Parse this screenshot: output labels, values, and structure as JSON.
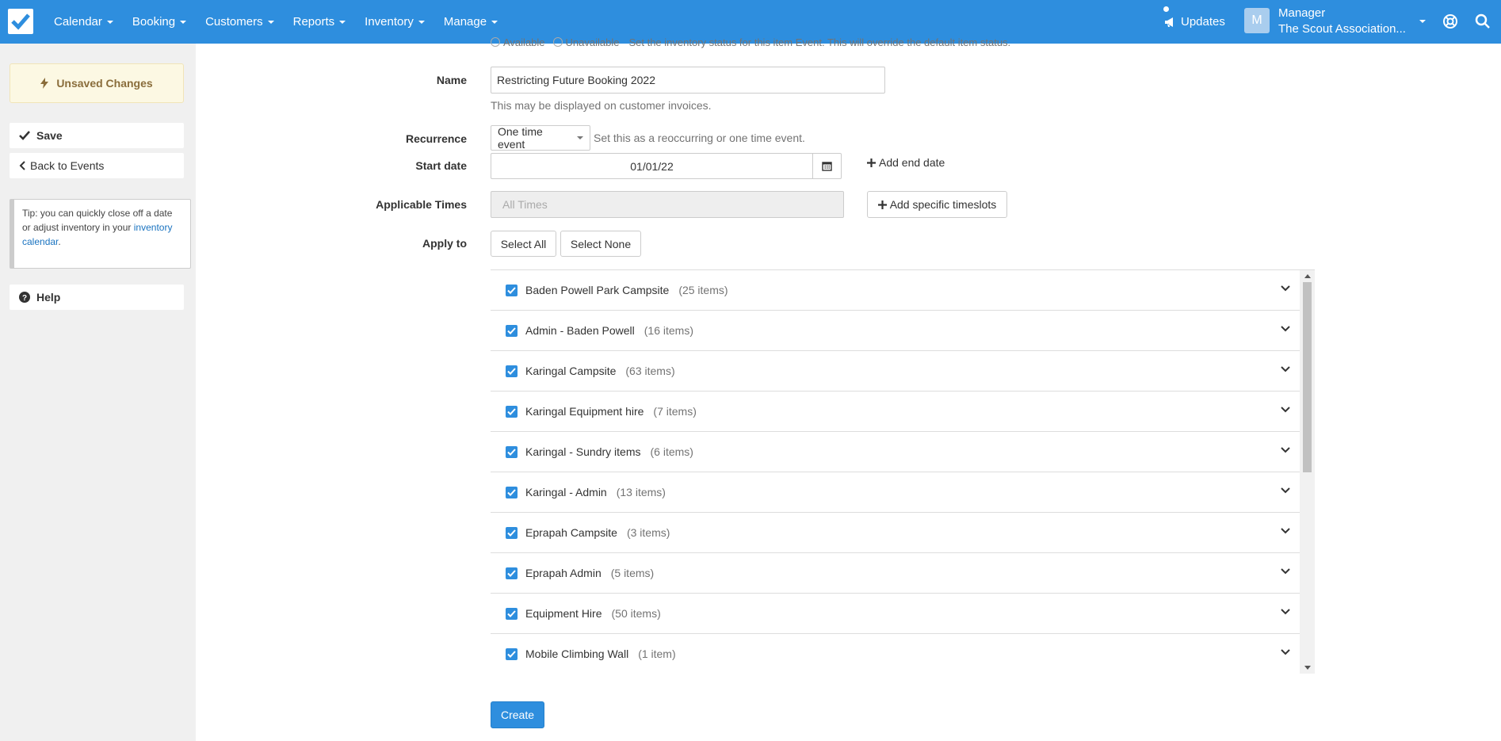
{
  "nav": {
    "items": [
      "Calendar",
      "Booking",
      "Customers",
      "Reports",
      "Inventory",
      "Manage"
    ],
    "updates": "Updates",
    "account": {
      "initial": "M",
      "role": "Manager",
      "org": "The Scout Association..."
    },
    "colors": {
      "bar": "#2e8ede"
    }
  },
  "sidebar": {
    "unsaved": "Unsaved Changes",
    "save": "Save",
    "back": "Back to Events",
    "tip": {
      "text": "Tip: you can quickly close off a date or adjust inventory in your",
      "link": "inventory calendar",
      "end": "."
    },
    "help": "Help"
  },
  "form": {
    "status": {
      "available": "Available",
      "unavailable": "Unavailable",
      "help": "Set the inventory status for this item Event. This will override the default item status."
    },
    "name": {
      "label": "Name",
      "value": "Restricting Future Booking 2022",
      "help": "This may be displayed on customer invoices."
    },
    "recurrence": {
      "label": "Recurrence",
      "value": "One time event",
      "help": "Set this as a reoccurring or one time event."
    },
    "start_date": {
      "label": "Start date",
      "value": "01/01/22",
      "add_end": "Add end date"
    },
    "times": {
      "label": "Applicable Times",
      "placeholder": "All Times",
      "add": "Add specific timeslots"
    },
    "apply": {
      "label": "Apply to",
      "select_all": "Select All",
      "select_none": "Select None"
    },
    "create": "Create"
  },
  "apply_list": [
    {
      "name": "Baden Powell Park Campsite",
      "count": "(25 items)",
      "checked": true
    },
    {
      "name": "Admin - Baden Powell",
      "count": "(16 items)",
      "checked": true
    },
    {
      "name": "Karingal Campsite",
      "count": "(63 items)",
      "checked": true
    },
    {
      "name": "Karingal Equipment hire",
      "count": "(7 items)",
      "checked": true
    },
    {
      "name": "Karingal - Sundry items",
      "count": "(6 items)",
      "checked": true
    },
    {
      "name": "Karingal - Admin",
      "count": "(13 items)",
      "checked": true
    },
    {
      "name": "Eprapah Campsite",
      "count": "(3 items)",
      "checked": true
    },
    {
      "name": "Eprapah Admin",
      "count": "(5 items)",
      "checked": true
    },
    {
      "name": "Equipment Hire",
      "count": "(50 items)",
      "checked": true
    },
    {
      "name": "Mobile Climbing Wall",
      "count": "(1 item)",
      "checked": true
    }
  ]
}
